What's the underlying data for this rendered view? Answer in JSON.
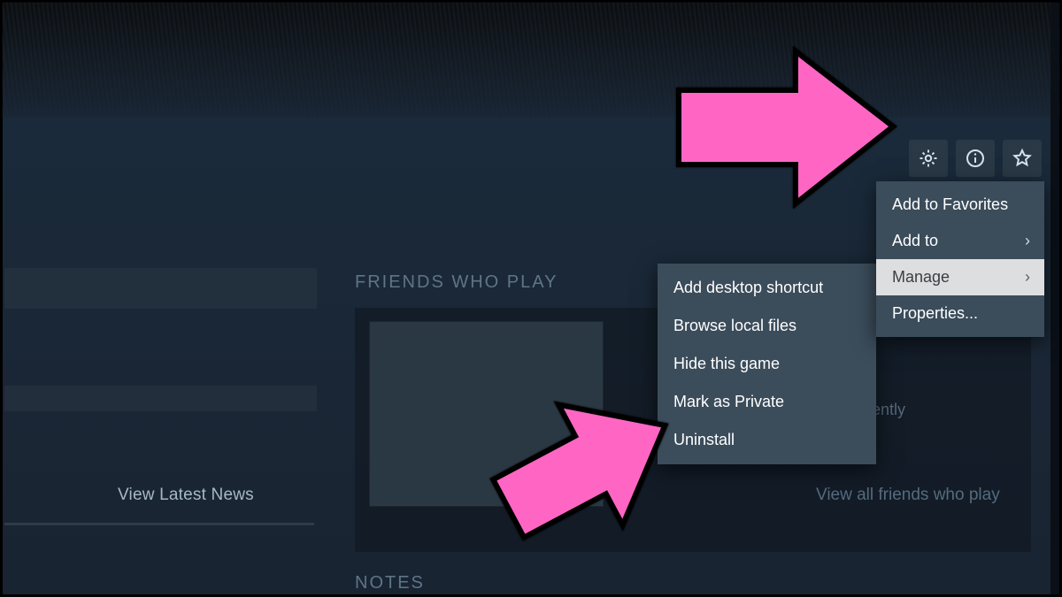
{
  "sections": {
    "friends_heading": "FRIENDS WHO PLAY",
    "notes_heading": "NOTES",
    "view_latest_news": "View Latest News",
    "friends_recent_fragment": "ecently",
    "friends_view_all": "View all friends who play"
  },
  "toolbar_icons": {
    "gear": "gear-icon",
    "info": "info-icon",
    "star": "star-icon"
  },
  "context_menu": {
    "items": [
      {
        "label": "Add to Favorites",
        "has_submenu": false,
        "selected": false
      },
      {
        "label": "Add to",
        "has_submenu": true,
        "selected": false
      },
      {
        "label": "Manage",
        "has_submenu": true,
        "selected": true
      },
      {
        "label": "Properties...",
        "has_submenu": false,
        "selected": false
      }
    ]
  },
  "manage_submenu": {
    "items": [
      {
        "label": "Add desktop shortcut"
      },
      {
        "label": "Browse local files"
      },
      {
        "label": "Hide this game"
      },
      {
        "label": "Mark as Private"
      },
      {
        "label": "Uninstall"
      }
    ]
  },
  "colors": {
    "annotation_pink": "#ff66c4"
  }
}
